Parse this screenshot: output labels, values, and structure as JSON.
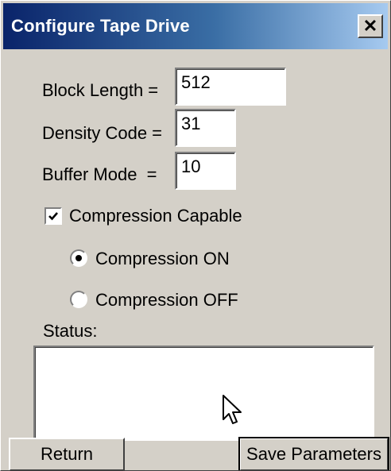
{
  "window": {
    "title": "Configure Tape Drive",
    "close_glyph": "✕"
  },
  "fields": {
    "block_length": {
      "label": "Block Length =",
      "value": "512"
    },
    "density_code": {
      "label": "Density Code =",
      "value": "31"
    },
    "buffer_mode": {
      "label": "Buffer Mode  =",
      "value": "10"
    }
  },
  "compression": {
    "capable_label": "Compression Capable",
    "capable_checked": true,
    "on_label": "Compression ON",
    "off_label": "Compression OFF",
    "selected": "on"
  },
  "status": {
    "label": "Status:",
    "text": ""
  },
  "buttons": {
    "return_label": "Return",
    "save_label": "Save Parameters"
  },
  "icons": {
    "close": "close-icon",
    "check": "checkmark-icon",
    "radio": "radio-dot-icon",
    "cursor": "mouse-pointer-icon"
  }
}
